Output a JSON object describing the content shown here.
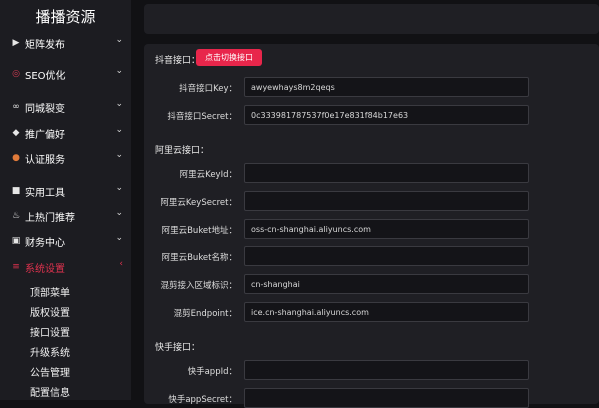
{
  "sidebar": {
    "title": "播播资源",
    "items": [
      {
        "label": "矩阵发布",
        "icon": "video-icon"
      },
      {
        "label": "SEO优化",
        "icon": "seo-icon"
      },
      {
        "label": "同城裂变",
        "icon": "link-icon"
      },
      {
        "label": "推广偏好",
        "icon": "thumbs-up-icon"
      },
      {
        "label": "认证服务",
        "icon": "badge-icon"
      },
      {
        "label": "实用工具",
        "icon": "toolbox-icon"
      },
      {
        "label": "上热门推荐",
        "icon": "fire-icon"
      },
      {
        "label": "财务中心",
        "icon": "wallet-icon"
      },
      {
        "label": "系统设置",
        "icon": "settings-icon"
      }
    ],
    "subitems": [
      "顶部菜单",
      "版权设置",
      "接口设置",
      "升级系统",
      "公告管理",
      "配置信息"
    ],
    "active_color": "#e0324e"
  },
  "main": {
    "douyin": {
      "section": "抖音接口：",
      "switch_label": "点击切换接口",
      "key_label": "抖音接口Key：",
      "key_value": "awyewhays8m2qeqs",
      "secret_label": "抖音接口Secret：",
      "secret_value": "0c333981787537f0e17e831f84b17e63"
    },
    "aliyun": {
      "section": "阿里云接口：",
      "keyid_label": "阿里云KeyId：",
      "keyid_value": "",
      "keysecret_label": "阿里云KeySecret：",
      "keysecret_value": "",
      "buket_label": "阿里云Buket地址：",
      "buket_value": "oss-cn-shanghai.aliyuncs.com",
      "buketname_label": "阿里云Buket名称：",
      "buketname_value": "",
      "region_label": "混剪接入区域标识：",
      "region_value": "cn-shanghai",
      "endpoint_label": "混剪Endpoint：",
      "endpoint_value": "ice.cn-shanghai.aliyuncs.com"
    },
    "kuaishou": {
      "section": "快手接口：",
      "appid_label": "快手appId：",
      "appid_value": "",
      "appsecret_label": "快手appSecret：",
      "appsecret_value": ""
    }
  },
  "colors": {
    "accent": "#e8264b",
    "background": "#111114",
    "panel": "#1f1f24",
    "sidebar": "#1c1c21"
  }
}
